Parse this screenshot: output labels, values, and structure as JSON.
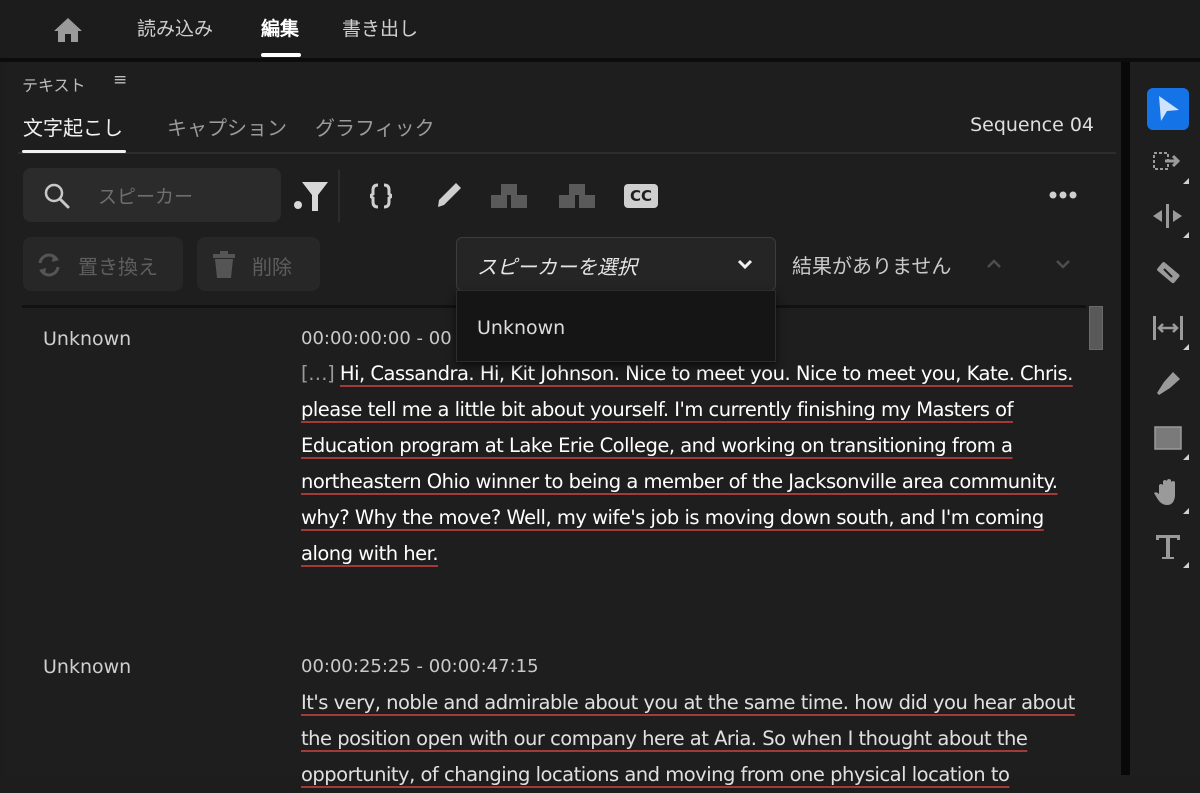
{
  "top_nav": {
    "home_icon": "home-icon",
    "items": [
      {
        "label": "読み込み",
        "active": false
      },
      {
        "label": "編集",
        "active": true
      },
      {
        "label": "書き出し",
        "active": false
      }
    ]
  },
  "panel": {
    "title": "テキスト",
    "menu_icon": "≡",
    "tabs": [
      {
        "label": "文字起こし",
        "active": true
      },
      {
        "label": "キャプション",
        "active": false
      },
      {
        "label": "グラフィック",
        "active": false
      }
    ],
    "sequence_name": "Sequence 04"
  },
  "toolbar": {
    "search_placeholder": "スピーカー",
    "filter_icon": "filter-icon",
    "icons": [
      "split-segment-icon",
      "edit-pencil-icon",
      "merge-segments-icon",
      "split-merge-icon",
      "cc-captions-icon"
    ],
    "cc_label": "CC",
    "more_icon": "more-icon",
    "replace_label": "置き換え",
    "delete_label": "削除",
    "speaker_select": {
      "value": "スピーカーを選択",
      "options": [
        "Unknown"
      ]
    },
    "no_results": "結果がありません"
  },
  "transcript": [
    {
      "speaker": "Unknown",
      "timecode": "00:00:00:00 - 00",
      "prefix": "[…]",
      "text": "Hi, Cassandra. Hi, Kit Johnson. Nice to meet you. Nice to meet you, Kate. Chris. please tell me a little bit about yourself. I'm currently finishing my Masters of Education program at Lake Erie College, and working on transitioning from a northeastern Ohio winner to being a member of the Jacksonville area community. why? Why the move? Well, my wife's job is moving down south, and I'm coming along with her."
    },
    {
      "speaker": "Unknown",
      "timecode": "00:00:25:25 - 00:00:47:15",
      "prefix": "",
      "text": "It's very, noble and admirable about you at the same time. how did you hear about the position open with our company here at Aria. So when I thought about the opportunity, of changing locations and moving from one physical location to"
    }
  ],
  "right_tools": [
    "selection-tool-icon",
    "track-select-icon",
    "ripple-edit-icon",
    "razor-icon",
    "slip-icon",
    "pen-icon",
    "rectangle-icon",
    "hand-icon",
    "type-icon"
  ],
  "colors": {
    "accent": "#1473e6",
    "background": "#1e1e1e",
    "underline": "#a33a3a"
  }
}
